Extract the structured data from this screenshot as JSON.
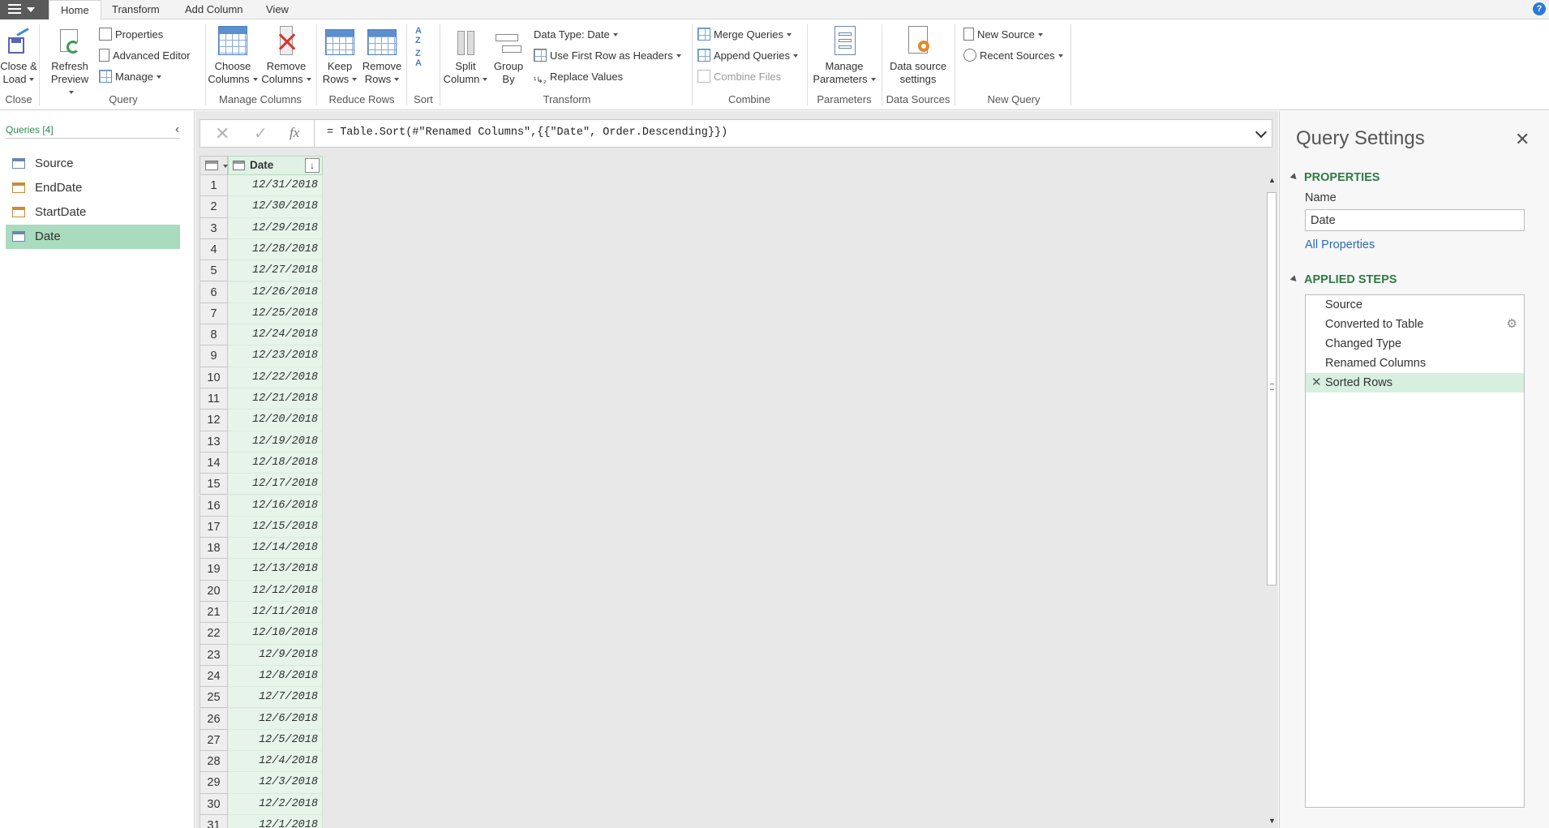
{
  "tabs": [
    "Home",
    "Transform",
    "Add Column",
    "View"
  ],
  "ribbon": {
    "close": {
      "line1": "Close &",
      "line2": "Load",
      "group": "Close"
    },
    "refresh": {
      "line1": "Refresh",
      "line2": "Preview",
      "group": "Query"
    },
    "properties": "Properties",
    "advanced_editor": "Advanced Editor",
    "manage": "Manage",
    "choose_columns": {
      "line1": "Choose",
      "line2": "Columns"
    },
    "remove_columns": {
      "line1": "Remove",
      "line2": "Columns"
    },
    "manage_columns_group": "Manage Columns",
    "keep_rows": {
      "line1": "Keep",
      "line2": "Rows"
    },
    "remove_rows": {
      "line1": "Remove",
      "line2": "Rows"
    },
    "reduce_rows_group": "Reduce Rows",
    "sort_group": "Sort",
    "split_column": {
      "line1": "Split",
      "line2": "Column"
    },
    "group_by": {
      "line1": "Group",
      "line2": "By"
    },
    "data_type": "Data Type: Date",
    "use_first_row": "Use First Row as Headers",
    "replace_values": "Replace Values",
    "transform_group": "Transform",
    "merge_queries": "Merge Queries",
    "append_queries": "Append Queries",
    "combine_files": "Combine Files",
    "combine_group": "Combine",
    "manage_parameters": {
      "line1": "Manage",
      "line2": "Parameters",
      "group": "Parameters"
    },
    "data_source_settings": {
      "line1": "Data source",
      "line2": "settings",
      "group": "Data Sources"
    },
    "new_source": "New Source",
    "recent_sources": "Recent Sources",
    "new_query_group": "New Query"
  },
  "queries": {
    "header": "Queries [4]",
    "items": [
      {
        "label": "Source",
        "icon": "table-icon"
      },
      {
        "label": "EndDate",
        "icon": "parameter-icon"
      },
      {
        "label": "StartDate",
        "icon": "parameter-icon"
      },
      {
        "label": "Date",
        "icon": "table-icon",
        "selected": true
      }
    ]
  },
  "formula": {
    "fx": "fx",
    "text": "= Table.Sort(#\"Renamed Columns\",{{\"Date\", Order.Descending}})"
  },
  "table": {
    "column": "Date",
    "rows": [
      "12/31/2018",
      "12/30/2018",
      "12/29/2018",
      "12/28/2018",
      "12/27/2018",
      "12/26/2018",
      "12/25/2018",
      "12/24/2018",
      "12/23/2018",
      "12/22/2018",
      "12/21/2018",
      "12/20/2018",
      "12/19/2018",
      "12/18/2018",
      "12/17/2018",
      "12/16/2018",
      "12/15/2018",
      "12/14/2018",
      "12/13/2018",
      "12/12/2018",
      "12/11/2018",
      "12/10/2018",
      "12/9/2018",
      "12/8/2018",
      "12/7/2018",
      "12/6/2018",
      "12/5/2018",
      "12/4/2018",
      "12/3/2018",
      "12/2/2018",
      "12/1/2018"
    ]
  },
  "settings": {
    "title": "Query Settings",
    "properties_header": "PROPERTIES",
    "name_label": "Name",
    "name_value": "Date",
    "all_properties": "All Properties",
    "applied_steps_header": "APPLIED STEPS",
    "steps": [
      {
        "label": "Source"
      },
      {
        "label": "Converted to Table",
        "gear": true
      },
      {
        "label": "Changed Type"
      },
      {
        "label": "Renamed Columns"
      },
      {
        "label": "Sorted Rows",
        "selected": true
      }
    ]
  }
}
